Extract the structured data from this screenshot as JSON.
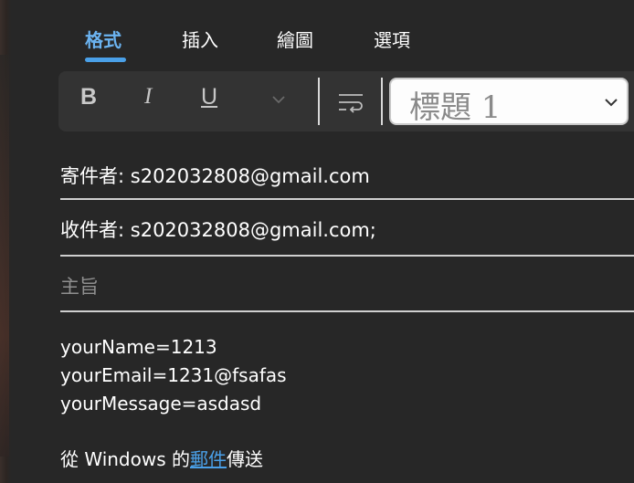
{
  "tabs": [
    {
      "label": "格式",
      "active": true
    },
    {
      "label": "插入",
      "active": false
    },
    {
      "label": "繪圖",
      "active": false
    },
    {
      "label": "選項",
      "active": false
    }
  ],
  "toolbar": {
    "bold_label": "B",
    "italic_label": "I",
    "underline_label": "U",
    "style_select": {
      "value": "標題 1"
    }
  },
  "header": {
    "from_label": "寄件者:",
    "from_value": "s202032808@gmail.com",
    "to_label": "收件者:",
    "to_value": "s202032808@gmail.com;",
    "subject_placeholder": "主旨"
  },
  "message": {
    "lines": [
      "yourName=1213",
      "yourEmail=1231@fsafas",
      "yourMessage=asdasd"
    ],
    "signature_prefix": "從 Windows 的",
    "signature_link": "郵件",
    "signature_suffix": "傳送"
  },
  "colors": {
    "background": "#272727",
    "accent": "#4aa0e8",
    "toolbar": "#333333"
  }
}
